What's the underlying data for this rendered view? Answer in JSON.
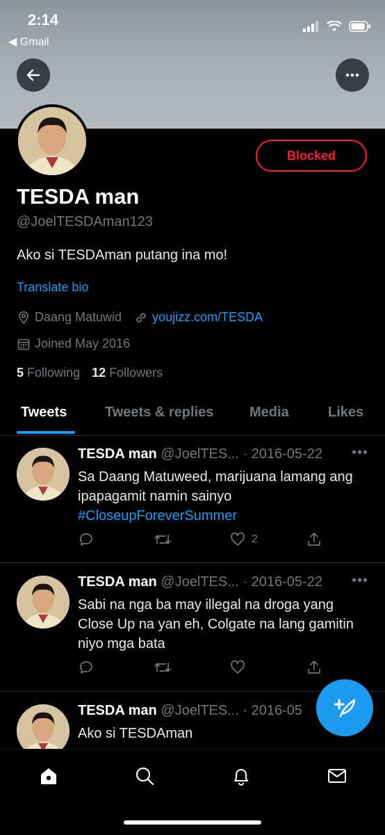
{
  "status_bar": {
    "time": "2:14",
    "back_app": "◀ Gmail"
  },
  "profile": {
    "name": "TESDA man",
    "handle": "@JoelTESDAman123",
    "bio": "Ako si TESDAman putang ina mo!",
    "translate_label": "Translate bio",
    "location": "Daang Matuwid",
    "website": "youjizz.com/TESDA",
    "joined": "Joined May 2016",
    "following_count": "5",
    "following_label": "Following",
    "followers_count": "12",
    "followers_label": "Followers",
    "blocked_label": "Blocked"
  },
  "tabs": [
    {
      "label": "Tweets",
      "active": true
    },
    {
      "label": "Tweets & replies"
    },
    {
      "label": "Media"
    },
    {
      "label": "Likes"
    }
  ],
  "tweets": [
    {
      "name": "TESDA man",
      "handle": "@JoelTES...",
      "date": "· 2016-05-22",
      "text": "Sa Daang Matuweed, marijuana lamang ang ipapagamit namin sainyo",
      "hashtag": "#CloseupForeverSummer",
      "likes": "2"
    },
    {
      "name": "TESDA man",
      "handle": "@JoelTES...",
      "date": "· 2016-05-22",
      "text": "Sabi na nga ba may illegal na droga yang Close Up na yan eh, Colgate na lang gamitin niyo mga bata",
      "hashtag": "",
      "likes": ""
    },
    {
      "name": "TESDA man",
      "handle": "@JoelTES...",
      "date": "· 2016-05",
      "text": "Ako si TESDAman",
      "hashtag": "",
      "likes": ""
    }
  ],
  "colors": {
    "accent": "#1d9bf0",
    "blocked": "#f4212e",
    "background": "#000000",
    "muted": "#71767b"
  },
  "icons": [
    "back-arrow-icon",
    "more-icon",
    "location-pin-icon",
    "link-icon",
    "calendar-icon",
    "reply-icon",
    "retweet-icon",
    "like-icon",
    "share-icon",
    "compose-icon",
    "home-icon",
    "search-icon",
    "notifications-icon",
    "messages-icon"
  ]
}
